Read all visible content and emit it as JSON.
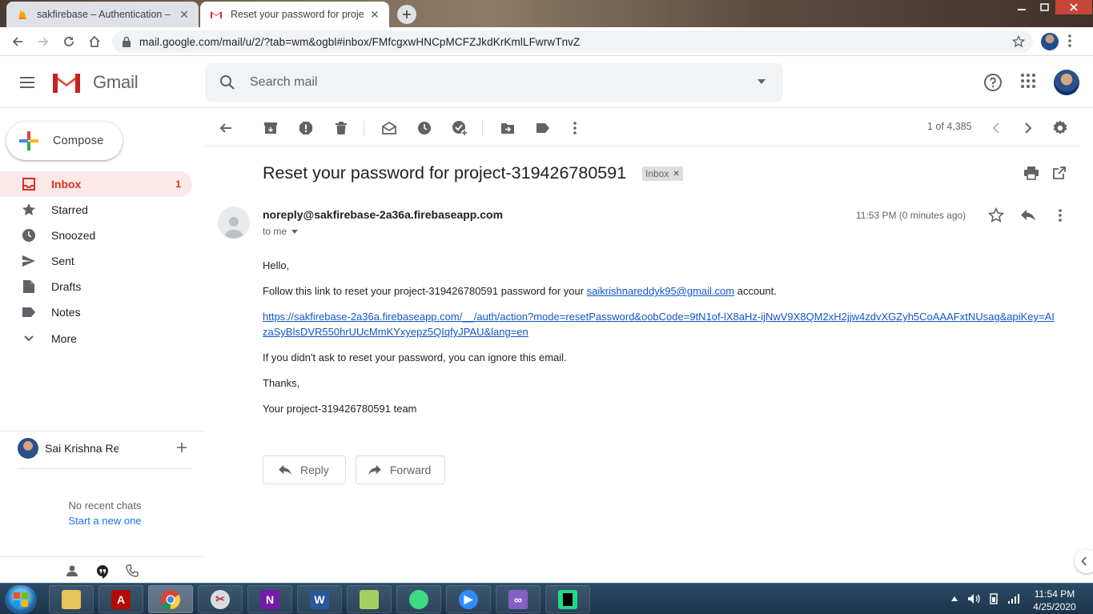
{
  "browser": {
    "tabs": [
      {
        "title": "sakfirebase – Authentication – Fi",
        "active": false
      },
      {
        "title": "Reset your password for project-",
        "active": true
      }
    ],
    "url": "mail.google.com/mail/u/2/?tab=wm&ogbl#inbox/FMfcgxwHNCpMCFZJkdKrKmlLFwrwTnvZ"
  },
  "gmail": {
    "logo_text": "Gmail",
    "search_placeholder": "Search mail"
  },
  "sidebar": {
    "compose_label": "Compose",
    "items": [
      {
        "label": "Inbox",
        "icon": "inbox-icon",
        "count": "1",
        "active": true
      },
      {
        "label": "Starred",
        "icon": "star-icon",
        "count": ""
      },
      {
        "label": "Snoozed",
        "icon": "clock-icon",
        "count": ""
      },
      {
        "label": "Sent",
        "icon": "send-icon",
        "count": ""
      },
      {
        "label": "Drafts",
        "icon": "draft-icon",
        "count": ""
      },
      {
        "label": "Notes",
        "icon": "label-icon",
        "count": ""
      },
      {
        "label": "More",
        "icon": "chevron-down-icon",
        "count": ""
      }
    ],
    "chat_user": "Sai Krishna Re(",
    "no_recent": "No recent chats",
    "start_new": "Start a new one"
  },
  "toolbar": {
    "pagination": "1 of 4,385"
  },
  "email": {
    "subject": "Reset your password for project-319426780591",
    "label_chip": "Inbox",
    "sender": "noreply@sakfirebase-2a36a.firebaseapp.com",
    "to": "to me",
    "time": "11:53 PM (0 minutes ago)",
    "greeting": "Hello,",
    "line1_pre": "Follow this link to reset your project-319426780591 password for your ",
    "line1_email": "saikrishnareddyk95@gmail.com",
    "line1_post": " account.",
    "reset_link": "https://sakfirebase-2a36a.firebaseapp.com/__/auth/action?mode=resetPassword&oobCode=9tN1of-lX8aHz-ijNwV9X8QM2xH2jjw4zdvXGZyh5CoAAAFxtNUsag&apiKey=AIzaSyBlsDVR550hrUUcMmKYxyepz5QIqfyJPAU&lang=en",
    "ignore_line": "If you didn't ask to reset your password, you can ignore this email.",
    "thanks": "Thanks,",
    "signature": "Your project-319426780591 team",
    "reply_label": "Reply",
    "forward_label": "Forward"
  },
  "taskbar": {
    "time": "11:54 PM",
    "date": "4/25/2020"
  },
  "colors": {
    "gmail_red": "#d93025",
    "link_blue": "#1155cc",
    "active_bg": "#fce8e6"
  }
}
